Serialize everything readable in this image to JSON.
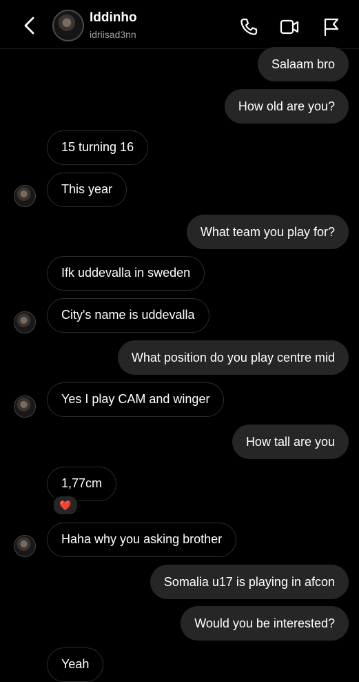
{
  "header": {
    "name": "Iddinho",
    "handle": "idriisad3nn"
  },
  "messages": [
    {
      "text": "Salaam bro"
    },
    {
      "text": "How old are you?"
    },
    {
      "text": "15 turning 16"
    },
    {
      "text": "This year"
    },
    {
      "text": "What team you play for?"
    },
    {
      "text": "Ifk uddevalla in sweden"
    },
    {
      "text": "City's name is uddevalla"
    },
    {
      "text": "What position do you play centre mid"
    },
    {
      "text": "Yes I play CAM and winger"
    },
    {
      "text": "How tall are you"
    },
    {
      "text": "1,77cm"
    },
    {
      "text": "Haha why you asking brother"
    },
    {
      "text": "Somalia u17 is playing in afcon"
    },
    {
      "text": "Would you be interested?"
    },
    {
      "text": "Yeah"
    }
  ],
  "reaction": "❤️",
  "icons": {
    "back": "chevron-left-icon",
    "call": "phone-icon",
    "video": "video-icon",
    "report": "flag-icon"
  }
}
